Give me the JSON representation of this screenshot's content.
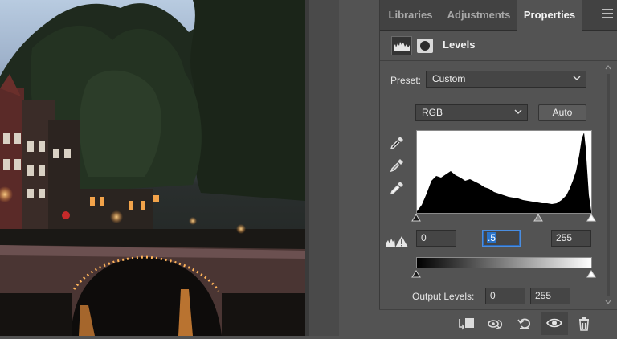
{
  "tabs": [
    {
      "label": "Libraries",
      "active": false
    },
    {
      "label": "Adjustments",
      "active": false
    },
    {
      "label": "Properties",
      "active": true
    }
  ],
  "header": {
    "title": "Levels",
    "icons": [
      "levels-adjustment-icon",
      "layer-mask-icon"
    ]
  },
  "preset": {
    "label": "Preset:",
    "value": "Custom"
  },
  "channel": {
    "value": "RGB",
    "auto_label": "Auto"
  },
  "eyedroppers": [
    "black-point-eyedropper-icon",
    "gray-point-eyedropper-icon",
    "white-point-eyedropper-icon"
  ],
  "input_levels": {
    "black": "0",
    "gamma": ".5",
    "white": "255"
  },
  "output_levels": {
    "label": "Output Levels:",
    "black": "0",
    "white": "255"
  },
  "bottom_icons": [
    "clip-to-layer-icon",
    "view-previous-state-icon",
    "reset-icon",
    "toggle-visibility-icon",
    "delete-icon"
  ],
  "colors": {
    "panel_bg": "#535353",
    "tab_bar_bg": "#424242",
    "field_bg": "#454545",
    "focus_blue": "#2a73c9"
  }
}
